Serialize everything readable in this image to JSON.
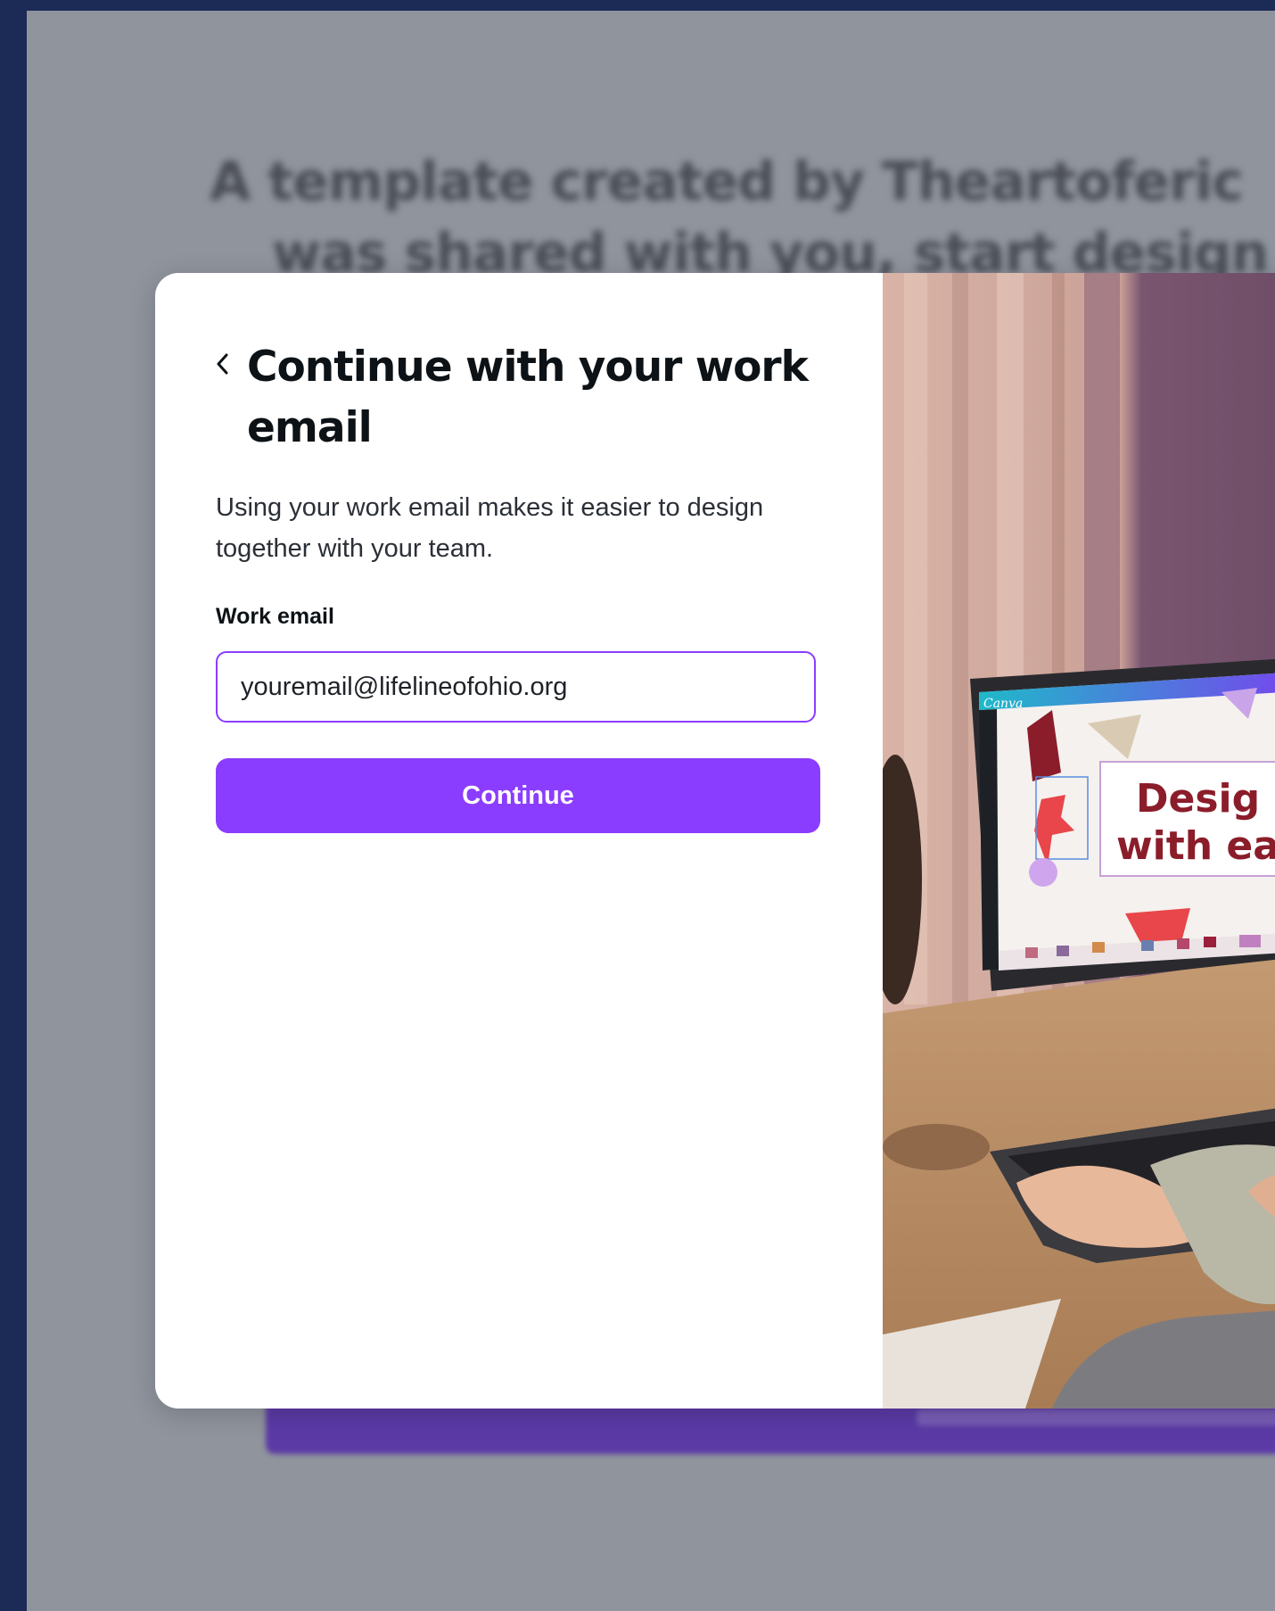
{
  "background": {
    "heading_line1": "A template created by Theartoferic",
    "heading_line2": "was shared with you, start design"
  },
  "modal": {
    "title": "Continue with your work email",
    "description": "Using your work email makes it easier to design together with your team.",
    "email_label": "Work email",
    "email_value": "youremail@lifelineofohio.org",
    "continue_label": "Continue"
  },
  "illustration": {
    "brand": "Canva",
    "headline_line1": "Desig",
    "headline_line2": "with ea"
  },
  "colors": {
    "accent": "#8b3dff",
    "frame": "#1c2a56",
    "overlay": "#8f949d"
  }
}
